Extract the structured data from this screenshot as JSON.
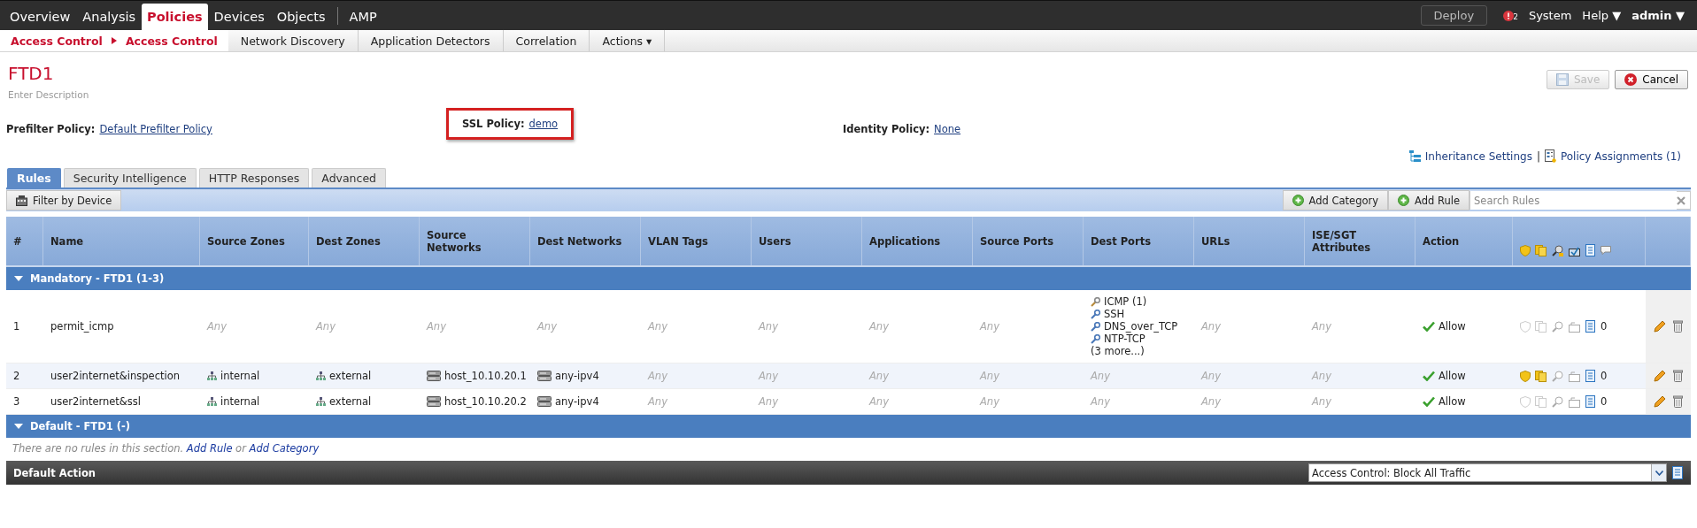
{
  "top_nav": {
    "items": [
      {
        "label": "Overview",
        "selected": false
      },
      {
        "label": "Analysis",
        "selected": false
      },
      {
        "label": "Policies",
        "selected": true
      },
      {
        "label": "Devices",
        "selected": false
      },
      {
        "label": "Objects",
        "selected": false
      },
      {
        "label": "AMP",
        "selected": false
      }
    ],
    "deploy": "Deploy",
    "alert_count": "2",
    "right_items": [
      "System",
      "Help ▼",
      "admin ▼"
    ]
  },
  "sub_nav": {
    "breadcrumb": [
      "Access Control",
      "Access Control"
    ],
    "items": [
      "Network Discovery",
      "Application Detectors",
      "Correlation",
      "Actions ▾"
    ]
  },
  "policy": {
    "title": "FTD1",
    "description": "Enter Description"
  },
  "buttons": [
    {
      "label": "Save",
      "disabled": true,
      "kind": "save"
    },
    {
      "label": "Cancel",
      "disabled": false,
      "kind": "cancel"
    }
  ],
  "policies": [
    {
      "label": "Prefilter Policy:",
      "value": "Default Prefilter Policy",
      "highlighted": false
    },
    {
      "label": "SSL Policy:",
      "value": "demo",
      "highlighted": true
    },
    {
      "label": "Identity Policy:",
      "value": "None",
      "highlighted": false
    }
  ],
  "links_separator": "|",
  "links": [
    {
      "label": "Inheritance Settings",
      "kind": "inheritance"
    },
    {
      "label": "Policy Assignments (1)",
      "kind": "assignments"
    }
  ],
  "tabs": [
    {
      "label": "Rules",
      "selected": true
    },
    {
      "label": "Security Intelligence",
      "selected": false
    },
    {
      "label": "HTTP Responses",
      "selected": false
    },
    {
      "label": "Advanced",
      "selected": false
    }
  ],
  "toolbar": {
    "filter": "Filter by Device",
    "buttons": [
      "Add Category",
      "Add Rule"
    ],
    "search": {
      "placeholder": "Search Rules"
    }
  },
  "table": {
    "columns": [
      "#",
      "Name",
      "Source Zones",
      "Dest Zones",
      "Source Networks",
      "Dest Networks",
      "VLAN Tags",
      "Users",
      "Applications",
      "Source Ports",
      "Dest Ports",
      "URLs",
      "ISE/SGT Attributes",
      "Action"
    ],
    "sections": [
      {
        "title": "Mandatory - FTD1 (1-3)",
        "expanded": true,
        "rows": [
          {
            "number": "1",
            "name": "permit_icmp",
            "cells": [
              [
                {
                  "kind": "any",
                  "text": "Any"
                }
              ],
              [
                {
                  "kind": "any",
                  "text": "Any"
                }
              ],
              [
                {
                  "kind": "any",
                  "text": "Any"
                }
              ],
              [
                {
                  "kind": "any",
                  "text": "Any"
                }
              ],
              [
                {
                  "kind": "any",
                  "text": "Any"
                }
              ],
              [
                {
                  "kind": "any",
                  "text": "Any"
                }
              ],
              [
                {
                  "kind": "any",
                  "text": "Any"
                }
              ],
              [
                {
                  "kind": "any",
                  "text": "Any"
                }
              ],
              [
                {
                  "kind": "icmp",
                  "text": "ICMP (1)"
                },
                {
                  "kind": "port",
                  "text": "SSH"
                },
                {
                  "kind": "port",
                  "text": "DNS_over_TCP"
                },
                {
                  "kind": "port",
                  "text": "NTP-TCP"
                },
                {
                  "kind": "more",
                  "text": "(3 more...)"
                }
              ],
              [
                {
                  "kind": "any",
                  "text": "Any"
                }
              ],
              [
                {
                  "kind": "any",
                  "text": "Any"
                }
              ]
            ],
            "action": "Allow",
            "intrusion": false,
            "file": false,
            "log_count": "0"
          },
          {
            "number": "2",
            "name": "user2internet&inspection",
            "cells": [
              [
                {
                  "kind": "zone",
                  "text": "internal"
                }
              ],
              [
                {
                  "kind": "zone",
                  "text": "external"
                }
              ],
              [
                {
                  "kind": "network",
                  "text": "host_10.10.20.1"
                }
              ],
              [
                {
                  "kind": "network",
                  "text": "any-ipv4"
                }
              ],
              [
                {
                  "kind": "any",
                  "text": "Any"
                }
              ],
              [
                {
                  "kind": "any",
                  "text": "Any"
                }
              ],
              [
                {
                  "kind": "any",
                  "text": "Any"
                }
              ],
              [
                {
                  "kind": "any",
                  "text": "Any"
                }
              ],
              [
                {
                  "kind": "any",
                  "text": "Any"
                }
              ],
              [
                {
                  "kind": "any",
                  "text": "Any"
                }
              ],
              [
                {
                  "kind": "any",
                  "text": "Any"
                }
              ]
            ],
            "action": "Allow",
            "intrusion": true,
            "file": true,
            "log_count": "0"
          },
          {
            "number": "3",
            "name": "user2internet&ssl",
            "cells": [
              [
                {
                  "kind": "zone",
                  "text": "internal"
                }
              ],
              [
                {
                  "kind": "zone",
                  "text": "external"
                }
              ],
              [
                {
                  "kind": "network",
                  "text": "host_10.10.20.2"
                }
              ],
              [
                {
                  "kind": "network",
                  "text": "any-ipv4"
                }
              ],
              [
                {
                  "kind": "any",
                  "text": "Any"
                }
              ],
              [
                {
                  "kind": "any",
                  "text": "Any"
                }
              ],
              [
                {
                  "kind": "any",
                  "text": "Any"
                }
              ],
              [
                {
                  "kind": "any",
                  "text": "Any"
                }
              ],
              [
                {
                  "kind": "any",
                  "text": "Any"
                }
              ],
              [
                {
                  "kind": "any",
                  "text": "Any"
                }
              ],
              [
                {
                  "kind": "any",
                  "text": "Any"
                }
              ]
            ],
            "action": "Allow",
            "intrusion": false,
            "file": false,
            "log_count": "0"
          }
        ]
      },
      {
        "title": "Default - FTD1 (-)",
        "expanded": true,
        "empty": {
          "text": "There are no rules in this section.",
          "link1": "Add Rule",
          "joiner": "or",
          "link2": "Add Category"
        }
      }
    ]
  },
  "default_action": {
    "label": "Default Action",
    "value": "Access Control: Block All Traffic"
  }
}
